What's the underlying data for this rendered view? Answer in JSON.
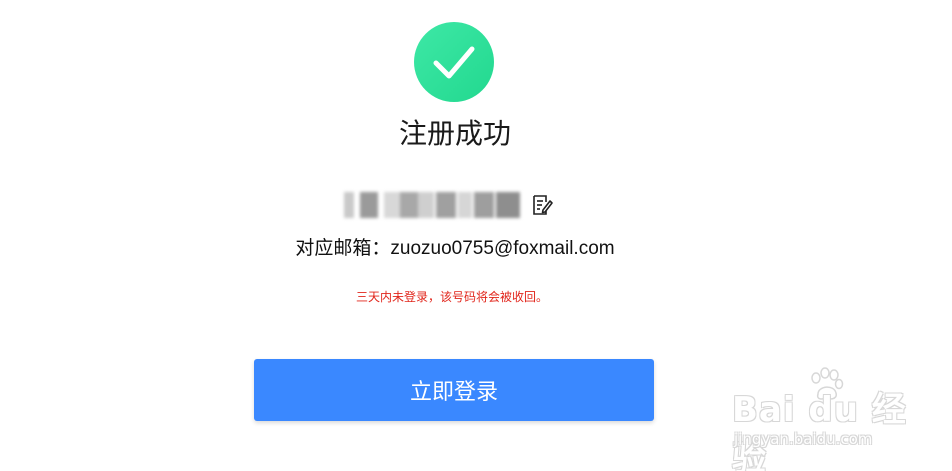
{
  "title": "注册成功",
  "account": {
    "icon": "edit-icon"
  },
  "email": {
    "label": "对应邮箱：",
    "value": "zuozuo0755@foxmail.com"
  },
  "warning": "三天内未登录，该号码将会被收回。",
  "login_button": "立即登录",
  "watermark": {
    "logo": "Bai du 经验",
    "url": "jingyan.baidu.com"
  },
  "colors": {
    "success": "#2ddf98",
    "button": "#3a88ff",
    "warning": "#e1251b"
  }
}
